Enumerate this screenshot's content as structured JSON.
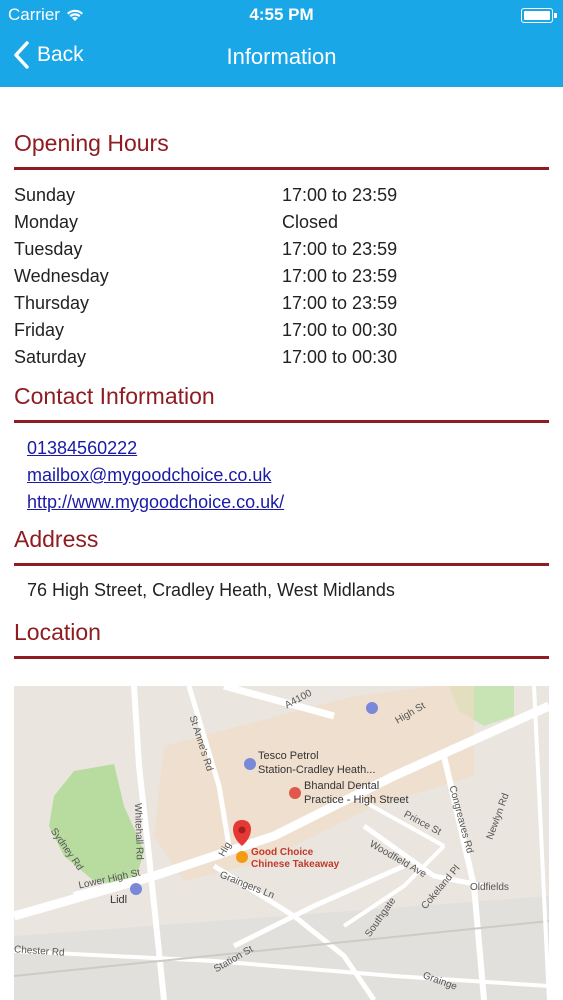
{
  "status": {
    "carrier": "Carrier",
    "time": "4:55 PM"
  },
  "nav": {
    "back_label": "Back",
    "title": "Information"
  },
  "opening_hours": {
    "title": "Opening Hours",
    "rows": [
      {
        "day": "Sunday",
        "hours": "17:00 to 23:59"
      },
      {
        "day": "Monday",
        "hours": "Closed"
      },
      {
        "day": "Tuesday",
        "hours": "17:00 to 23:59"
      },
      {
        "day": "Wednesday",
        "hours": "17:00 to 23:59"
      },
      {
        "day": "Thursday",
        "hours": "17:00 to 23:59"
      },
      {
        "day": "Friday",
        "hours": "17:00 to 00:30"
      },
      {
        "day": "Saturday",
        "hours": "17:00 to 00:30"
      }
    ]
  },
  "contact": {
    "title": "Contact Information",
    "phone": "01384560222",
    "email": "mailbox@mygoodchoice.co.uk",
    "website": "http://www.mygoodchoice.co.uk/"
  },
  "address": {
    "title": "Address",
    "text": "76 High Street, Cradley Heath, West Midlands"
  },
  "location": {
    "title": "Location",
    "map_labels": {
      "a4100": "A4100",
      "high_st_top": "High St",
      "st_annes_rd": "St Anne's Rd",
      "tesco": "Tesco Petrol",
      "tesco2": "Station-Cradley Heath...",
      "bhandal": "Bhandal Dental",
      "bhandal2": "Practice - High Street",
      "whitehall_rd": "Whitehall Rd",
      "prince_st": "Prince St",
      "congreaves_rd": "Congreaves Rd",
      "newlyn_rd": "Newlyn Rd",
      "pin_name1": "Good Choice",
      "pin_name2": "Chinese Takeaway",
      "high_partial": "Hig",
      "woodfield_ave": "Woodfield Ave",
      "sydney_rd": "Sydney Rd",
      "lower_high_st": "Lower High St",
      "graingers_ln": "Graingers Ln",
      "oldfields": "Oldfields",
      "lidl": "Lidl",
      "southgate": "Southgate",
      "cokeland_pl": "Cokeland Pl",
      "chester_rd": "Chester Rd",
      "station_st": "Station St",
      "grainge": "Grainge"
    }
  }
}
